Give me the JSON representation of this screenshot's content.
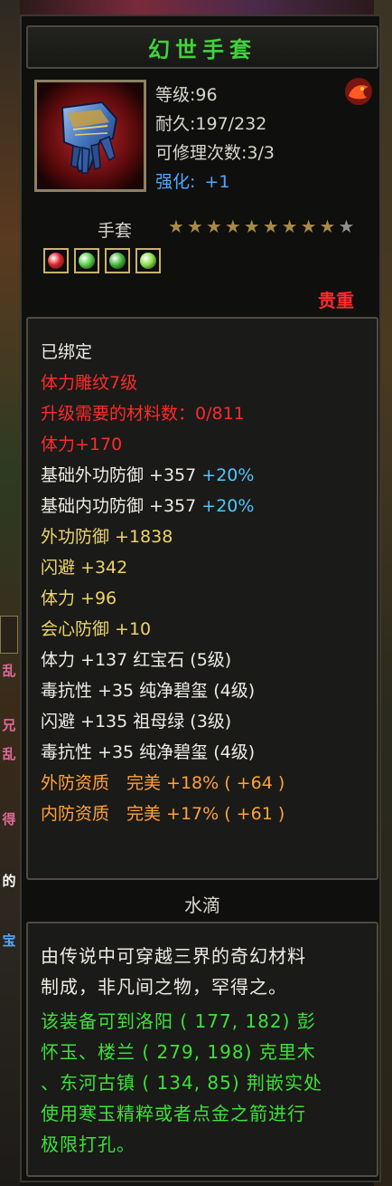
{
  "item": {
    "name": "幻世手套",
    "level_text": "等级:96",
    "durability_text": "耐久:197/232",
    "repair_text": "可修理次数:3/3",
    "enhance_label": "强化:",
    "enhance_value": "+1",
    "category": "手套",
    "stars_filled": 9,
    "stars_total": 10,
    "rarity": "贵重",
    "icon": "gauntlet-icon"
  },
  "gems": [
    {
      "icon": "ruby-gem-icon",
      "color": "#e0202a"
    },
    {
      "icon": "jade-gem-icon",
      "color": "#5cd04a"
    },
    {
      "icon": "jade-gem-icon",
      "color": "#46b838"
    },
    {
      "icon": "jade-gem-icon",
      "color": "#8ee048"
    }
  ],
  "attributes": {
    "bound": "已绑定",
    "engrave": "体力雕纹7级",
    "upgrade_req": "升级需要的材料数：0/811",
    "stamina_bonus": "体力+170",
    "base_ext_def": {
      "label": "基础外功防御 +357",
      "pct": "+20%"
    },
    "base_int_def": {
      "label": "基础内功防御 +357",
      "pct": "+20%"
    },
    "ext_def": "外功防御 +1838",
    "dodge": "闪避 +342",
    "stamina": "体力 +96",
    "crit_def": "会心防御 +10",
    "gem_lines": [
      "体力 +137 红宝石 (5级)",
      "毒抗性 +35 纯净碧玺 (4级)",
      "闪避 +135 祖母绿 (3级)",
      "毒抗性 +35 纯净碧玺 (4级)"
    ],
    "quality_ext": "外防资质　完美 +18% ( +64 )",
    "quality_int": "内防资质　完美 +17% ( +61 )"
  },
  "material_section": {
    "header": "水滴",
    "desc_lines": [
      "由传说中可穿越三界的奇幻材料",
      "制成，非凡间之物，罕得之。"
    ],
    "location_lines": [
      "该装备可到洛阳 ( 177, 182) 彭",
      "怀玉、楼兰 ( 279, 198) 克里木",
      "、东河古镇 ( 134, 85) 荆嵌实处",
      "使用寒玉精粹或者点金之箭进行",
      "极限打孔。"
    ]
  },
  "side_glyphs": [
    "乱",
    "兄",
    "乱",
    "得",
    "的",
    "宝"
  ],
  "colors": {
    "title_green": "#3fd33b",
    "attr_red": "#ff2a2a",
    "attr_yellow": "#ecd46a",
    "attr_cyan": "#4fc7ff",
    "attr_orange": "#ffa23a",
    "desc_green": "#3fe03a"
  }
}
